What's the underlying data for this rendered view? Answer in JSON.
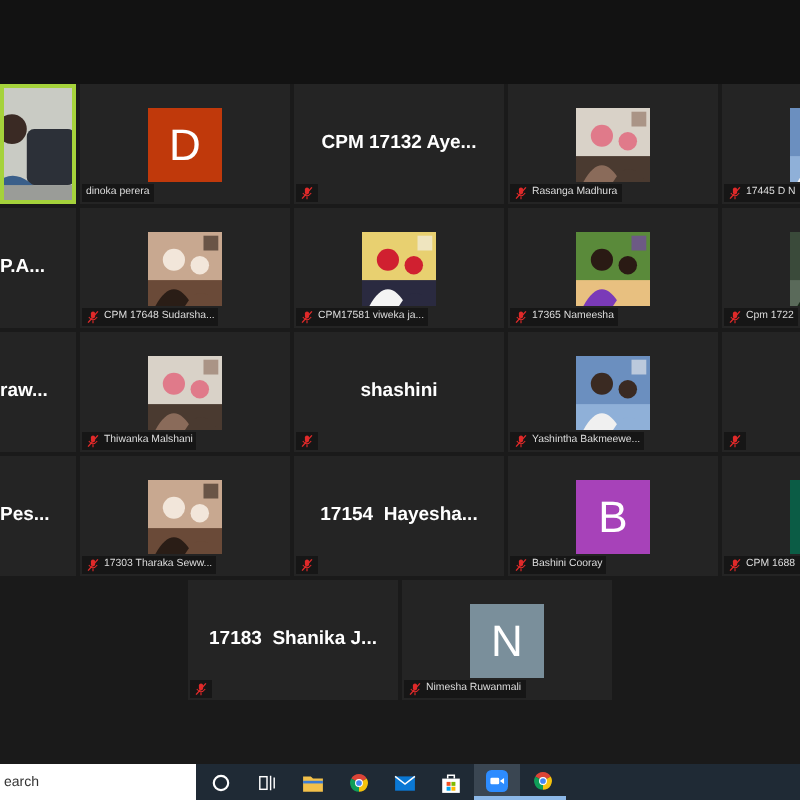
{
  "gallery": {
    "rows": [
      {
        "tiles": [
          {
            "kind": "video",
            "speaking": true
          },
          {
            "kind": "avatar",
            "letter": "D",
            "color": "#c0390b",
            "label": "dinoka perera",
            "muted": false
          },
          {
            "kind": "name",
            "title": "CPM 17132 Aye...",
            "muted": true
          },
          {
            "label": "Rasanga Madhura",
            "muted": true
          },
          {
            "label": "17445 D N",
            "muted": true
          }
        ]
      },
      {
        "tiles": [
          {
            "kind": "name",
            "title": "P.A..."
          },
          {
            "label": "CPM 17648 Sudarsha...",
            "muted": true
          },
          {
            "label": "CPM17581 viweka ja...",
            "muted": true
          },
          {
            "label": "17365 Nameesha",
            "muted": true
          },
          {
            "label": "Cpm 1722",
            "muted": true
          }
        ]
      },
      {
        "tiles": [
          {
            "kind": "name",
            "title": "raw..."
          },
          {
            "label": "Thiwanka Malshani",
            "muted": true
          },
          {
            "kind": "name",
            "title": "shashini",
            "muted": true
          },
          {
            "label": "Yashintha Bakmeewe...",
            "muted": true
          },
          {
            "kind": "blank",
            "muted": true
          }
        ]
      },
      {
        "tiles": [
          {
            "kind": "name",
            "title": "Pes..."
          },
          {
            "label": "17303 Tharaka Seww...",
            "muted": true
          },
          {
            "kind": "name",
            "title": "17154  Hayesha...",
            "muted": true
          },
          {
            "kind": "avatar",
            "letter": "B",
            "color": "#a742b9",
            "label": "Bashini Cooray",
            "muted": true
          },
          {
            "kind": "avatar",
            "color": "#0b5c45",
            "label": "CPM 1688",
            "muted": true
          }
        ]
      },
      {
        "tiles": [
          {
            "kind": "name",
            "title": "17183  Shanika J...",
            "muted": true
          },
          {
            "kind": "avatar",
            "letter": "N",
            "color": "#7a8f9b",
            "label": "Nimesha Ruwanmali",
            "muted": true
          }
        ]
      }
    ]
  },
  "taskbar": {
    "search": {
      "placeholder": "earch"
    },
    "apps": [
      {
        "kind": "cortana",
        "running": false,
        "selected": false
      },
      {
        "kind": "taskview",
        "running": false,
        "selected": false
      },
      {
        "kind": "explorer",
        "running": false,
        "selected": false
      },
      {
        "kind": "chrome",
        "running": false,
        "selected": false
      },
      {
        "kind": "mail",
        "running": false,
        "selected": false
      },
      {
        "kind": "store",
        "running": false,
        "selected": false
      },
      {
        "kind": "zoom",
        "running": true,
        "selected": true
      },
      {
        "kind": "chrome",
        "running": true,
        "selected": false
      }
    ]
  }
}
